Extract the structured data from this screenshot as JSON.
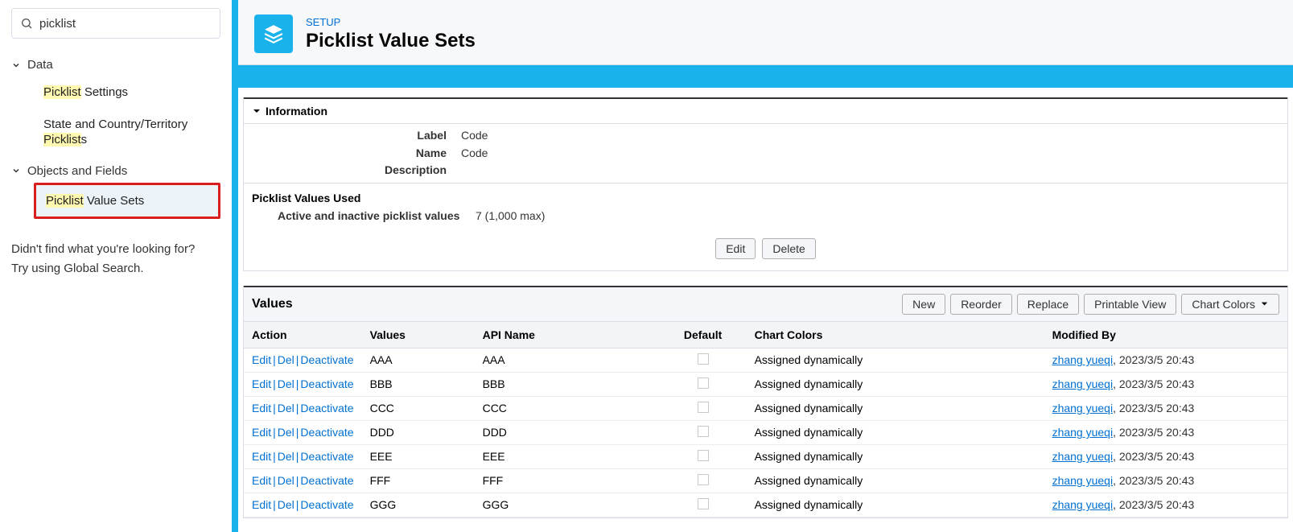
{
  "search": {
    "value": "picklist"
  },
  "sidebar": {
    "sections": [
      {
        "label": "Data",
        "items": [
          {
            "pre_hl": "Picklist",
            "post": " Settings"
          },
          {
            "pre": "State and Country/Territory ",
            "hl": "Picklist",
            "post2": "s"
          }
        ]
      },
      {
        "label": "Objects and Fields",
        "items": [
          {
            "pre_hl": "Picklist",
            "post": " Value Sets"
          }
        ]
      }
    ],
    "help1": "Didn't find what you're looking for?",
    "help2": "Try using Global Search."
  },
  "header": {
    "breadcrumb": "SETUP",
    "title": "Picklist Value Sets"
  },
  "info": {
    "section_title": "Information",
    "label_lbl": "Label",
    "label_val": "Code",
    "name_lbl": "Name",
    "name_val": "Code",
    "desc_lbl": "Description",
    "desc_val": ""
  },
  "pvu": {
    "header": "Picklist Values Used",
    "row_lbl": "Active and inactive picklist values",
    "row_val": "7 (1,000 max)"
  },
  "buttons": {
    "edit": "Edit",
    "delete": "Delete"
  },
  "values_section": {
    "title": "Values",
    "actions": {
      "new": "New",
      "reorder": "Reorder",
      "replace": "Replace",
      "printable": "Printable View",
      "chartcolors": "Chart Colors"
    },
    "columns": {
      "action": "Action",
      "values": "Values",
      "api": "API Name",
      "default": "Default",
      "colors": "Chart Colors",
      "modby": "Modified By"
    },
    "row_actions": {
      "edit": "Edit",
      "del": "Del",
      "deact": "Deactivate"
    },
    "rows": [
      {
        "value": "AAA",
        "api": "AAA",
        "colors": "Assigned dynamically",
        "mod_user": "zhang yueqi",
        "mod_ts": "2023/3/5 20:43"
      },
      {
        "value": "BBB",
        "api": "BBB",
        "colors": "Assigned dynamically",
        "mod_user": "zhang yueqi",
        "mod_ts": "2023/3/5 20:43"
      },
      {
        "value": "CCC",
        "api": "CCC",
        "colors": "Assigned dynamically",
        "mod_user": "zhang yueqi",
        "mod_ts": "2023/3/5 20:43"
      },
      {
        "value": "DDD",
        "api": "DDD",
        "colors": "Assigned dynamically",
        "mod_user": "zhang yueqi",
        "mod_ts": "2023/3/5 20:43"
      },
      {
        "value": "EEE",
        "api": "EEE",
        "colors": "Assigned dynamically",
        "mod_user": "zhang yueqi",
        "mod_ts": "2023/3/5 20:43"
      },
      {
        "value": "FFF",
        "api": "FFF",
        "colors": "Assigned dynamically",
        "mod_user": "zhang yueqi",
        "mod_ts": "2023/3/5 20:43"
      },
      {
        "value": "GGG",
        "api": "GGG",
        "colors": "Assigned dynamically",
        "mod_user": "zhang yueqi",
        "mod_ts": "2023/3/5 20:43"
      }
    ]
  }
}
